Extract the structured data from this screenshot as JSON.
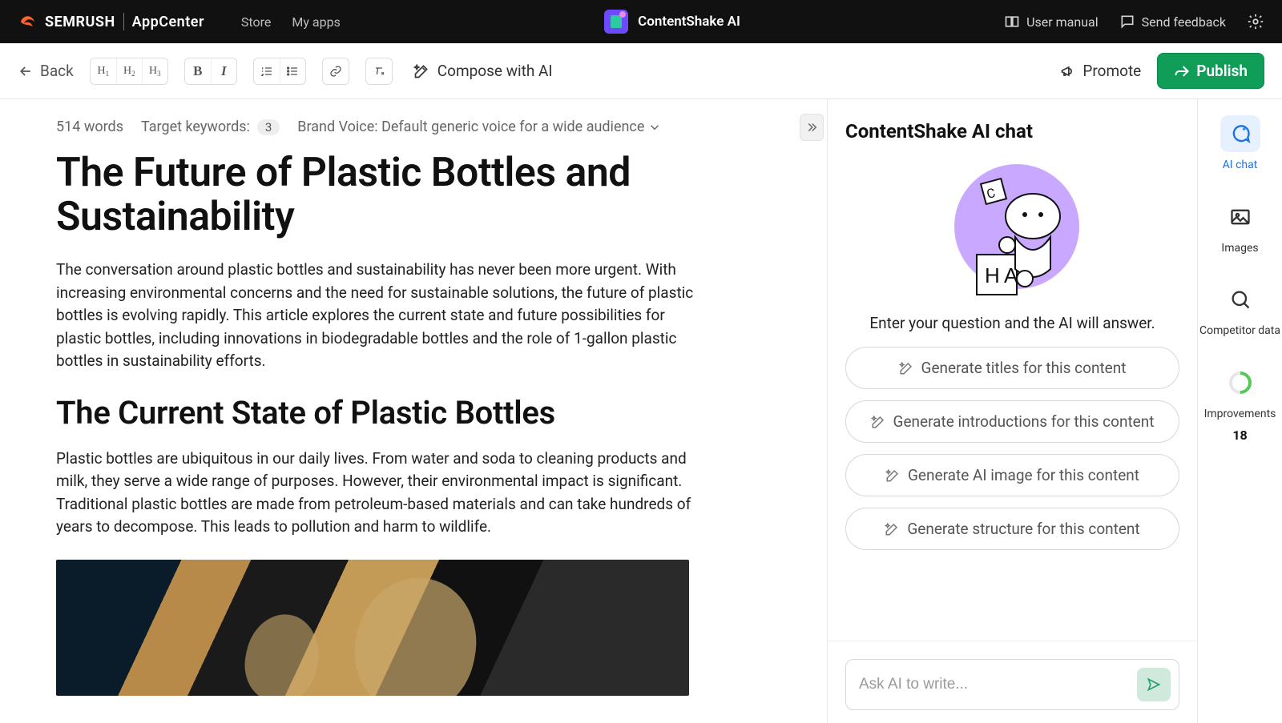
{
  "header": {
    "brand_main": "SEMRUSH",
    "brand_sub": "AppCenter",
    "nav": {
      "store": "Store",
      "my_apps": "My apps"
    },
    "app_name": "ContentShake AI",
    "user_manual": "User manual",
    "send_feedback": "Send feedback"
  },
  "toolbar": {
    "back": "Back",
    "compose": "Compose with AI",
    "promote": "Promote",
    "publish": "Publish"
  },
  "meta": {
    "word_count": "514 words",
    "target_kw_label": "Target keywords:",
    "target_kw_count": "3",
    "brand_voice_label": "Brand Voice: Default generic voice for a wide audience"
  },
  "article": {
    "title": "The Future of Plastic Bottles and Sustainability",
    "p1": "The conversation around plastic bottles and sustainability has never been more urgent. With increasing environmental concerns and the need for sustainable solutions, the future of plastic bottles is evolving rapidly. This article explores the current state and future possibilities for plastic bottles, including innovations in biodegradable bottles and the role of 1-gallon plastic bottles in sustainability efforts.",
    "h2": "The Current State of Plastic Bottles",
    "p2": "Plastic bottles are ubiquitous in our daily lives. From water and soda to cleaning products and milk, they serve a wide range of purposes. However, their environmental impact is significant. Traditional plastic bottles are made from petroleum-based materials and can take hundreds of years to decompose. This leads to pollution and harm to wildlife."
  },
  "chat": {
    "title": "ContentShake AI chat",
    "hint": "Enter your question and the AI will answer.",
    "suggestions": {
      "titles": "Generate titles for this content",
      "intros": "Generate introductions for this content",
      "image": "Generate AI image for this content",
      "structure": "Generate structure for this content"
    },
    "input_placeholder": "Ask AI to write..."
  },
  "rail": {
    "ai_chat": "AI chat",
    "images": "Images",
    "competitor": "Competitor data",
    "improvements_label": "Improvements",
    "improvements_count": "18"
  }
}
